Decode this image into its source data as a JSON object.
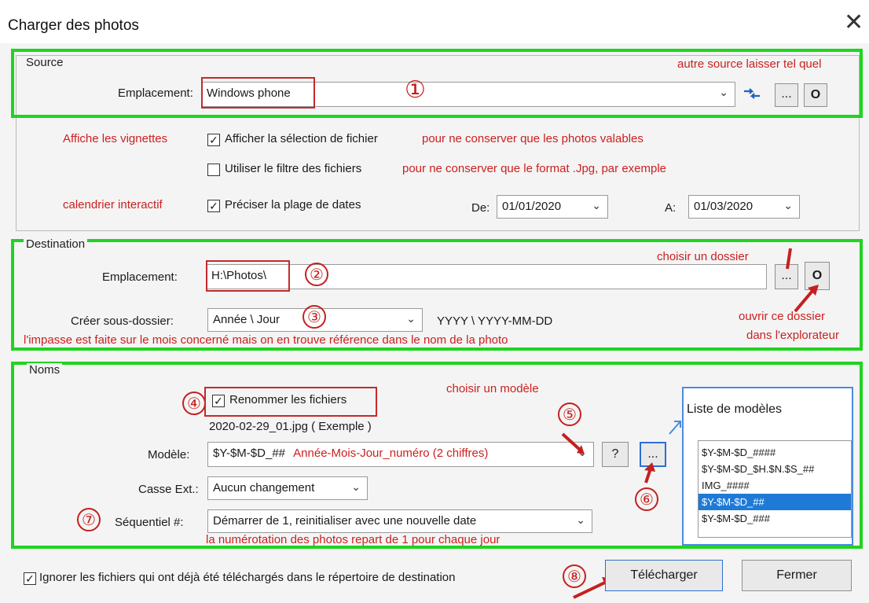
{
  "window": {
    "title": "Charger des photos",
    "close_glyph": "✕"
  },
  "source": {
    "legend": "Source",
    "location_label": "Emplacement:",
    "location_value": "Windows phone",
    "refresh_icon": "refresh-arrows-icon",
    "browse_label": "...",
    "open_label": "O",
    "note_other": "autre source laisser tel quel",
    "show_selection_label": "Afficher la sélection de fichier",
    "show_selection_checked": true,
    "use_filter_label": "Utiliser le filtre des fichiers",
    "use_filter_checked": false,
    "date_range_label": "Préciser la plage de dates",
    "date_range_checked": true,
    "from_label": "De:",
    "from_value": "01/01/2020",
    "to_label": "A:",
    "to_value": "01/03/2020",
    "note_thumbs": "Affiche les vignettes",
    "note_valid": "pour ne conserver que les photos valables",
    "note_jpg": "pour ne conserver que le format .Jpg, par exemple",
    "note_calendar": "calendrier interactif"
  },
  "destination": {
    "legend": "Destination",
    "location_label": "Emplacement:",
    "location_value": "H:\\Photos\\",
    "browse_label": "...",
    "open_label": "O",
    "subfolder_label": "Créer sous-dossier:",
    "subfolder_value": "Année \\ Jour",
    "subfolder_format": "YYYY \\ YYYY-MM-DD",
    "note_choose": "choisir un dossier",
    "note_open_line1": "ouvrir ce dossier",
    "note_open_line2": "dans l'explorateur",
    "note_month": "l'impasse est faite sur le mois concerné mais on en trouve référence dans le nom de la photo"
  },
  "names": {
    "legend": "Noms",
    "rename_label": "Renommer les fichiers",
    "rename_checked": true,
    "example": "2020-02-29_01.jpg   ( Exemple )",
    "model_label": "Modèle:",
    "model_value": "$Y-$M-$D_##",
    "model_note": "Année-Mois-Jour_numéro (2 chiffres)",
    "help_label": "?",
    "models_button_label": "...",
    "case_label": "Casse Ext.:",
    "case_value": "Aucun changement",
    "seq_label": "Séquentiel #:",
    "seq_value": "Démarrer de 1, reinitialiser avec une nouvelle date",
    "note_choose_model": "choisir un modèle",
    "note_numbering": "la numérotation des photos repart  de 1 pour chaque jour",
    "models_list_title": "Liste de modèles",
    "models_list": [
      "$Y-$M-$D_####",
      "$Y-$M-$D_$H.$N.$S_##",
      "IMG_####",
      "$Y-$M-$D_##",
      "$Y-$M-$D_###"
    ],
    "models_list_selected": 3
  },
  "footer": {
    "ignore_label": "Ignorer les fichiers qui ont déjà été téléchargés dans le répertoire de destination",
    "ignore_checked": true,
    "download_label": "Télécharger",
    "close_label": "Fermer"
  },
  "markers": [
    "①",
    "②",
    "③",
    "④",
    "⑤",
    "⑥",
    "⑦",
    "⑧"
  ],
  "colors": {
    "highlight_green": "#1fd41f",
    "annotation_red": "#cc2020",
    "selection_blue": "#1e7ad6"
  }
}
